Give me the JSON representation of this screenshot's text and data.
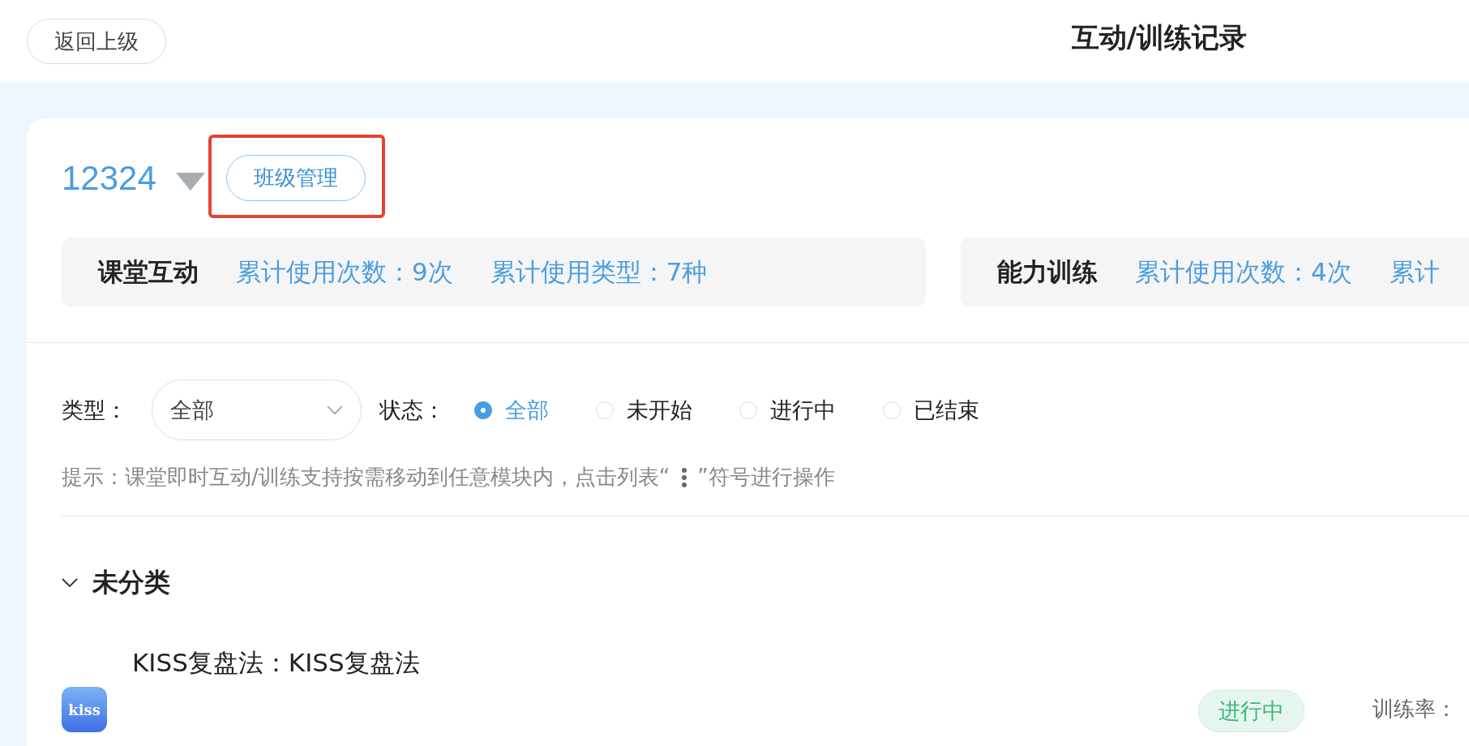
{
  "header": {
    "back_button": "返回上级",
    "title": "互动/训练记录"
  },
  "class_bar": {
    "class_name": "12324",
    "manage_button": {
      "label": "班级管理",
      "highlighted": true
    }
  },
  "stats": [
    {
      "title": "课堂互动",
      "items": [
        "累计使用次数：9次",
        "累计使用类型：7种"
      ]
    },
    {
      "title": "能力训练",
      "items": [
        "累计使用次数：4次",
        "累计"
      ]
    }
  ],
  "filters": {
    "type_label": "类型：",
    "type_select": "全部",
    "status_label": "状态：",
    "status_options": [
      {
        "label": "全部",
        "selected": true
      },
      {
        "label": "未开始",
        "selected": false
      },
      {
        "label": "进行中",
        "selected": false
      },
      {
        "label": "已结束",
        "selected": false
      }
    ]
  },
  "hint": {
    "before": "提示：课堂即时互动/训练支持按需移动到任意模块内，点击列表“",
    "after": "”符号进行操作"
  },
  "section": {
    "title": "未分类",
    "expanded": true,
    "items": [
      {
        "logo": "kiss",
        "title": "KISS复盘法：KISS复盘法",
        "status": "进行中",
        "metric_label": "训练率："
      }
    ]
  }
}
